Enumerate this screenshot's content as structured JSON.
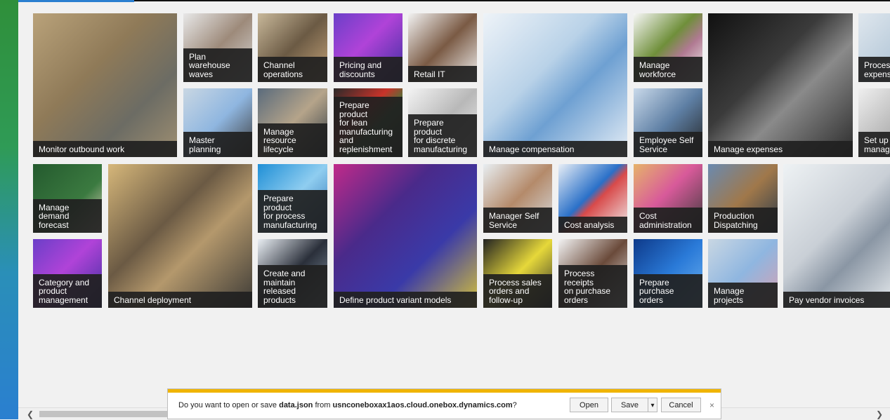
{
  "tiles": [
    {
      "id": "monitor-outbound-work",
      "lines": [
        "Monitor outbound work"
      ],
      "bg": "linear-gradient(135deg,#b9a27a,#8f7a58 40%,#6c6c64 70%,#a09072)"
    },
    {
      "id": "plan-warehouse-waves",
      "lines": [
        "Plan warehouse",
        "waves"
      ],
      "bg": "linear-gradient(135deg,#e8e8e8,#9d8a7a 50%,#d8d8d8)"
    },
    {
      "id": "channel-operations",
      "lines": [
        "Channel",
        "operations"
      ],
      "bg": "linear-gradient(135deg,#c8b89a,#6b5a44 50%,#c7a57a)"
    },
    {
      "id": "pricing-and-discounts",
      "lines": [
        "Pricing and",
        "discounts"
      ],
      "bg": "linear-gradient(135deg,#6b3fc8,#b043d8 45%,#3a2f9e)"
    },
    {
      "id": "retail-it",
      "lines": [
        "Retail IT"
      ],
      "bg": "linear-gradient(135deg,#f2f2f2,#7a5a44 50%,#f0f0f0)"
    },
    {
      "id": "manage-compensation",
      "lines": [
        "Manage compensation"
      ],
      "bg": "linear-gradient(135deg,#eef3f8,#b9d2e8 40%,#6ea0d2 60%,#e6eef6)"
    },
    {
      "id": "manage-workforce",
      "lines": [
        "Manage",
        "workforce"
      ],
      "bg": "linear-gradient(135deg,#f7f7f7,#6f8f3a 45%,#b07a92 65%,#f5f5f5)"
    },
    {
      "id": "manage-expenses",
      "lines": [
        "Manage expenses"
      ],
      "bg": "linear-gradient(135deg,#111,#3b3b3b 40%,#8a8a8a 60%,#2a2a2a)"
    },
    {
      "id": "process-expenses",
      "lines": [
        "Process",
        "expens"
      ],
      "bg": "linear-gradient(135deg,#dfe7ee,#a9bfd2)"
    },
    {
      "id": "master-planning",
      "lines": [
        "Master planning"
      ],
      "bg": "linear-gradient(135deg,#c9d7e3,#8fb6e0 50%,#3b3a3a)"
    },
    {
      "id": "manage-resource-lifecycle",
      "lines": [
        "Manage",
        "resource",
        "lifecycle"
      ],
      "bg": "linear-gradient(135deg,#5a6b7c,#b5a48a 50%,#2a3540)"
    },
    {
      "id": "prepare-product-lean",
      "lines": [
        "Prepare product",
        "for lean",
        "manufacturing",
        "and",
        "replenishment"
      ],
      "bg": "linear-gradient(135deg,#2a2a2a,#c8332a 40%,#3d7a3a 60%,#222)"
    },
    {
      "id": "prepare-product-discrete",
      "lines": [
        "Prepare product",
        "for discrete",
        "manufacturing"
      ],
      "bg": "linear-gradient(135deg,#f3f3f3,#b8b8b8 50%,#f0f0f0)"
    },
    {
      "id": "employee-self-service",
      "lines": [
        "Employee Self",
        "Service"
      ],
      "bg": "linear-gradient(135deg,#c9d9ea,#5e7fa4 50%,#222)"
    },
    {
      "id": "set-up-manage",
      "lines": [
        "Set up",
        "manag"
      ],
      "bg": "linear-gradient(135deg,#efefef,#9a9a9a)"
    },
    {
      "id": "manage-demand-forecast",
      "lines": [
        "Manage",
        "demand",
        "forecast"
      ],
      "bg": "linear-gradient(135deg,#245a2e,#3b7a40 60%,#e9d9c4)"
    },
    {
      "id": "channel-deployment",
      "lines": [
        "Channel deployment"
      ],
      "bg": "linear-gradient(135deg,#d6b77a,#6b5a44 40%,#b4986c 60%,#3c3a36)"
    },
    {
      "id": "prepare-product-process",
      "lines": [
        "Prepare product",
        "for process",
        "manufacturing"
      ],
      "bg": "linear-gradient(135deg,#1f8fd6,#8fcdf0 50%,#2b6fb0)"
    },
    {
      "id": "define-product-variant-models",
      "lines": [
        "Define product variant models"
      ],
      "bg": "linear-gradient(135deg,#c02a8a,#4a2a8a 35%,#3a3aa8 65%,#d6c23a)"
    },
    {
      "id": "manager-self-service",
      "lines": [
        "Manager Self",
        "Service"
      ],
      "bg": "linear-gradient(135deg,#e8eef2,#b48a6a 50%,#d7dde2)"
    },
    {
      "id": "cost-analysis",
      "lines": [
        "Cost analysis"
      ],
      "bg": "linear-gradient(135deg,#e8eef6,#2a70c8 45%,#d84a4a 55%,#f0f0f0)"
    },
    {
      "id": "cost-administration",
      "lines": [
        "Cost",
        "administration"
      ],
      "bg": "linear-gradient(135deg,#e6b36a,#d85a9a 45%,#3a3a3a)"
    },
    {
      "id": "production-dispatching",
      "lines": [
        "Production",
        "Dispatching"
      ],
      "bg": "linear-gradient(135deg,#6a8ab0,#a0784a 50%,#2a3a4a)"
    },
    {
      "id": "pay-vendor-invoices",
      "lines": [
        "Pay vendor invoices"
      ],
      "bg": "linear-gradient(135deg,#eef2f4,#c9cfd6 45%,#8a96a4 65%,#e8ecef)"
    },
    {
      "id": "category-product-management",
      "lines": [
        "Category and",
        "product",
        "management"
      ],
      "bg": "linear-gradient(135deg,#6b3fc8,#b043d8 45%,#3a2f9e)"
    },
    {
      "id": "create-maintain-released",
      "lines": [
        "Create and",
        "maintain",
        "released",
        "products"
      ],
      "bg": "linear-gradient(135deg,#e9eef3,#2a2f3a 50%,#8a9aa8)"
    },
    {
      "id": "process-sales-orders",
      "lines": [
        "Process sales",
        "orders and",
        "follow-up"
      ],
      "bg": "linear-gradient(135deg,#222,#e6d83a 50%,#2a2a2a)"
    },
    {
      "id": "process-receipts",
      "lines": [
        "Process receipts",
        "on purchase",
        "orders"
      ],
      "bg": "linear-gradient(135deg,#f3f3f3,#6a4a3a 50%,#efefef)"
    },
    {
      "id": "prepare-purchase-orders",
      "lines": [
        "Prepare",
        "purchase orders"
      ],
      "bg": "linear-gradient(135deg,#0e3a8a,#2a7ad8 50%,#6fb3f0)"
    },
    {
      "id": "manage-projects",
      "lines": [
        "Manage",
        "projects"
      ],
      "bg": "linear-gradient(135deg,#c9d7e3,#8fb6e0 50%,#d9a0b0)"
    }
  ],
  "download_bar": {
    "prefix": "Do you want to open or save ",
    "filename": "data.json",
    "middle": " from ",
    "domain": "usnconeboxax1aos.cloud.onebox.dynamics.com",
    "suffix": "?",
    "open_label": "Open",
    "save_label": "Save",
    "save_arrow": "▾",
    "cancel_label": "Cancel",
    "close_glyph": "×"
  },
  "scrollbar": {
    "left_glyph": "❮",
    "right_glyph": "❯"
  }
}
